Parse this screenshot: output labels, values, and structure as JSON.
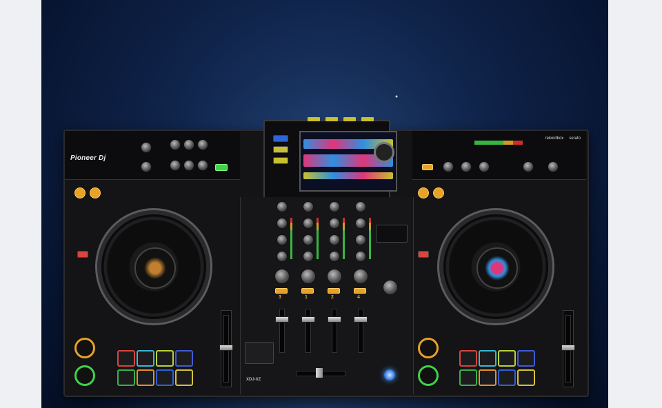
{
  "scene": {
    "device": "Pioneer DJ XDJ-XZ",
    "logo_text": "Pioneer Dj",
    "brand_right": [
      "rekordbox",
      "serato"
    ],
    "model_badge": "XDJ-XZ",
    "channel_numbers": [
      "3",
      "1",
      "2",
      "4"
    ],
    "pad_colors": [
      "#d8443e",
      "#39b7d8",
      "#bcd23a",
      "#3f5bd8",
      "#35b24a",
      "#e8902a",
      "#2f63d6",
      "#d6c23a"
    ],
    "jog_ring_colors": {
      "top": "#e8a227",
      "bottom": "#3fd34a"
    },
    "screen_wave_colors": [
      "#2f8fe0",
      "#e0367a",
      "#c8c030"
    ],
    "accent_amber": "#e8a227",
    "background": "#0b1a3a"
  }
}
